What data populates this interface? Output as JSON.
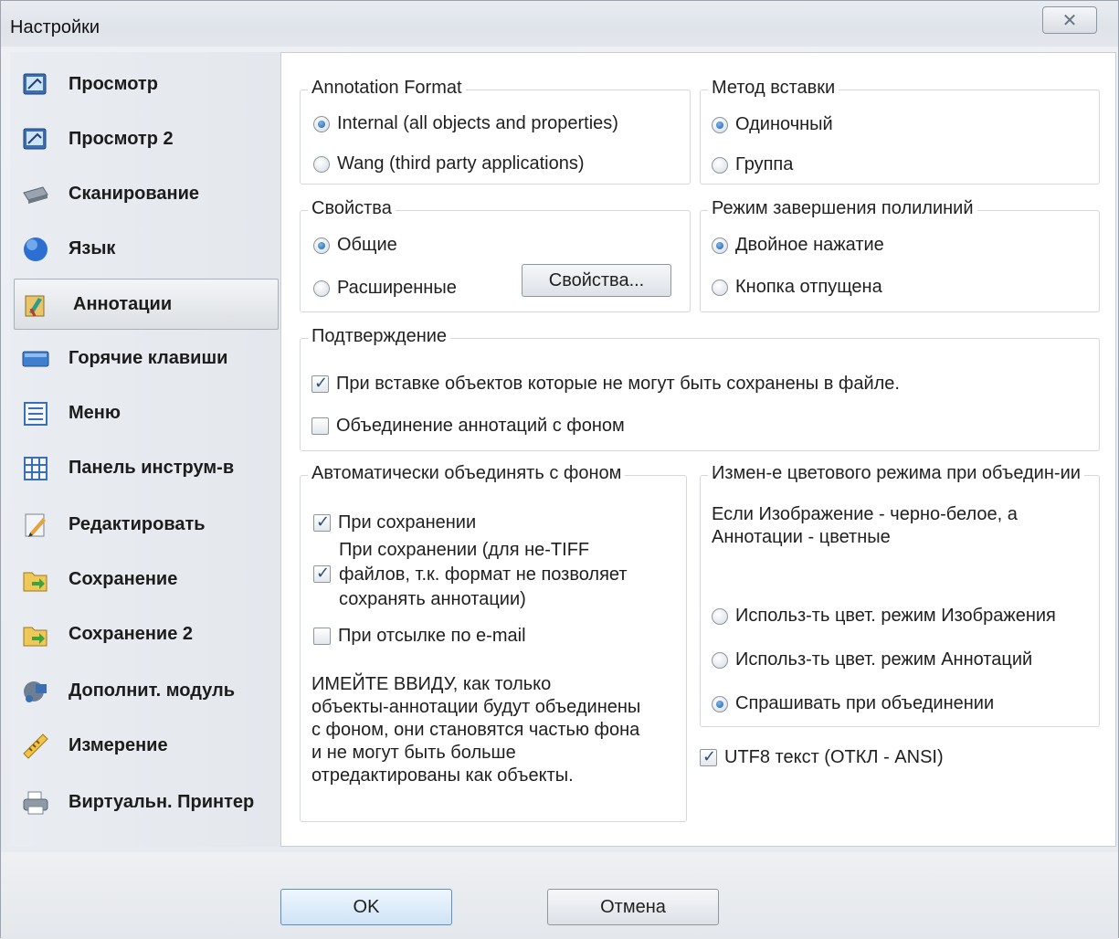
{
  "window": {
    "title": "Настройки",
    "close_icon": "close-icon"
  },
  "sidebar": {
    "items": [
      {
        "label": "Просмотр",
        "icon": "view-icon"
      },
      {
        "label": "Просмотр 2",
        "icon": "view-icon"
      },
      {
        "label": "Сканирование",
        "icon": "scanner-icon"
      },
      {
        "label": "Язык",
        "icon": "globe-icon"
      },
      {
        "label": "Аннотации",
        "icon": "annotation-icon",
        "active": true
      },
      {
        "label": "Горячие клавиши",
        "icon": "keyboard-icon"
      },
      {
        "label": "Меню",
        "icon": "menu-icon"
      },
      {
        "label": "Панель инструм-в",
        "icon": "toolbar-icon"
      },
      {
        "label": "Редактировать",
        "icon": "edit-icon"
      },
      {
        "label": "Сохранение",
        "icon": "save-icon"
      },
      {
        "label": "Сохранение 2",
        "icon": "save-icon"
      },
      {
        "label": "Дополнит. модуль",
        "icon": "plugin-icon"
      },
      {
        "label": "Измерение",
        "icon": "ruler-icon"
      },
      {
        "label": "Виртуальн. Принтер",
        "icon": "printer-icon"
      }
    ]
  },
  "annotation_format": {
    "title": "Annotation Format",
    "option_internal": "Internal (all objects and properties)",
    "option_wang": "Wang (third party applications)",
    "selected": "internal"
  },
  "insert_method": {
    "title": "Метод вставки",
    "option_single": "Одиночный",
    "option_group": "Группа",
    "selected": "single"
  },
  "properties": {
    "title": "Свойства",
    "option_general": "Общие",
    "option_extended": "Расширенные",
    "button": "Свойства...",
    "selected": "general"
  },
  "polyline_mode": {
    "title": "Режим завершения полилиний",
    "option_double": "Двойное нажатие",
    "option_released": "Кнопка отпущена",
    "selected": "double"
  },
  "confirmation": {
    "title": "Подтверждение",
    "check_insert": "При вставке объектов которые не могут быть сохранены в файле.",
    "check_insert_on": true,
    "check_merge": "Объединение аннотаций с фоном",
    "check_merge_on": false
  },
  "auto_merge": {
    "title": "Автоматически объединять с фоном",
    "check_save": "При сохранении",
    "check_save_on": true,
    "check_nontiff_line1": "При сохранении (для не-TIFF",
    "check_nontiff_line2": "файлов, т.к. формат не позволяет",
    "check_nontiff_line3": "сохранять аннотации)",
    "check_nontiff_on": true,
    "check_email": "При отсылке по e-mail",
    "check_email_on": false,
    "note_line1": "ИМЕЙТЕ ВВИДУ, как только",
    "note_line2": "объекты-аннотации будут объединены",
    "note_line3": "с фоном, они становятся частью фона",
    "note_line4": "и не могут быть больше",
    "note_line5": "отредактированы как объекты."
  },
  "color_mode": {
    "title": "Измен-е цветового режима при объедин-ии",
    "desc_line1": "Если Изображение - черно-белое, а",
    "desc_line2": "Аннотации - цветные",
    "option_image": "Использ-ть цвет. режим Изображения",
    "option_annot": "Использ-ть цвет. режим Аннотаций",
    "option_ask": "Спрашивать при объединении",
    "selected": "ask"
  },
  "utf8": {
    "label": "UTF8 текст (ОТКЛ - ANSI)",
    "on": true
  },
  "footer": {
    "ok": "OK",
    "cancel": "Отмена"
  }
}
